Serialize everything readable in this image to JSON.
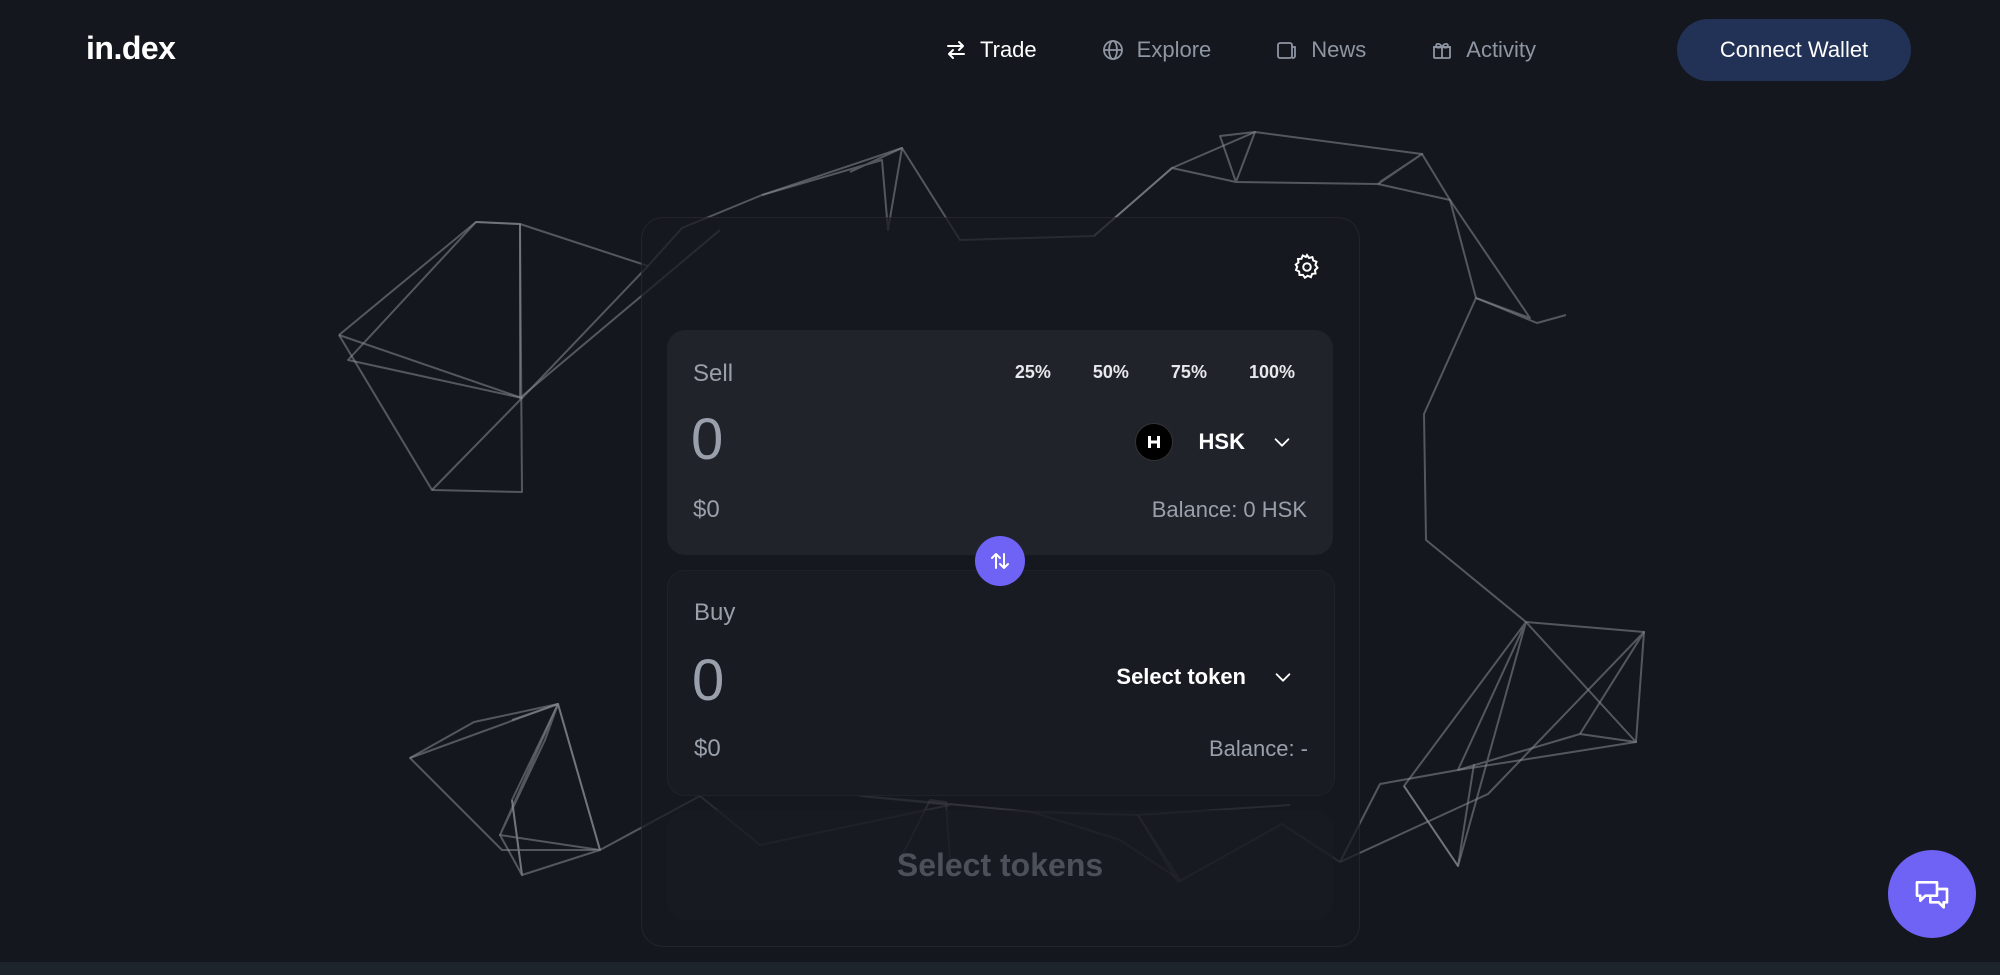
{
  "header": {
    "logo": "in.dex",
    "nav": [
      {
        "label": "Trade",
        "icon": "arrows-swap-icon",
        "active": true
      },
      {
        "label": "Explore",
        "icon": "globe-icon",
        "active": false
      },
      {
        "label": "News",
        "icon": "news-icon",
        "active": false
      },
      {
        "label": "Activity",
        "icon": "gift-icon",
        "active": false
      }
    ],
    "connect_label": "Connect Wallet"
  },
  "swap": {
    "sell": {
      "label": "Sell",
      "amount": "0",
      "usd": "$0",
      "percents": [
        "25%",
        "50%",
        "75%",
        "100%"
      ],
      "token": "HSK",
      "balance": "Balance: 0 HSK"
    },
    "buy": {
      "label": "Buy",
      "amount": "0",
      "usd": "$0",
      "token_placeholder": "Select token",
      "balance": "Balance: -"
    },
    "submit_label": "Select tokens"
  },
  "colors": {
    "background": "#14171d",
    "accent": "#6e63f5",
    "connect_button": "#223256"
  }
}
